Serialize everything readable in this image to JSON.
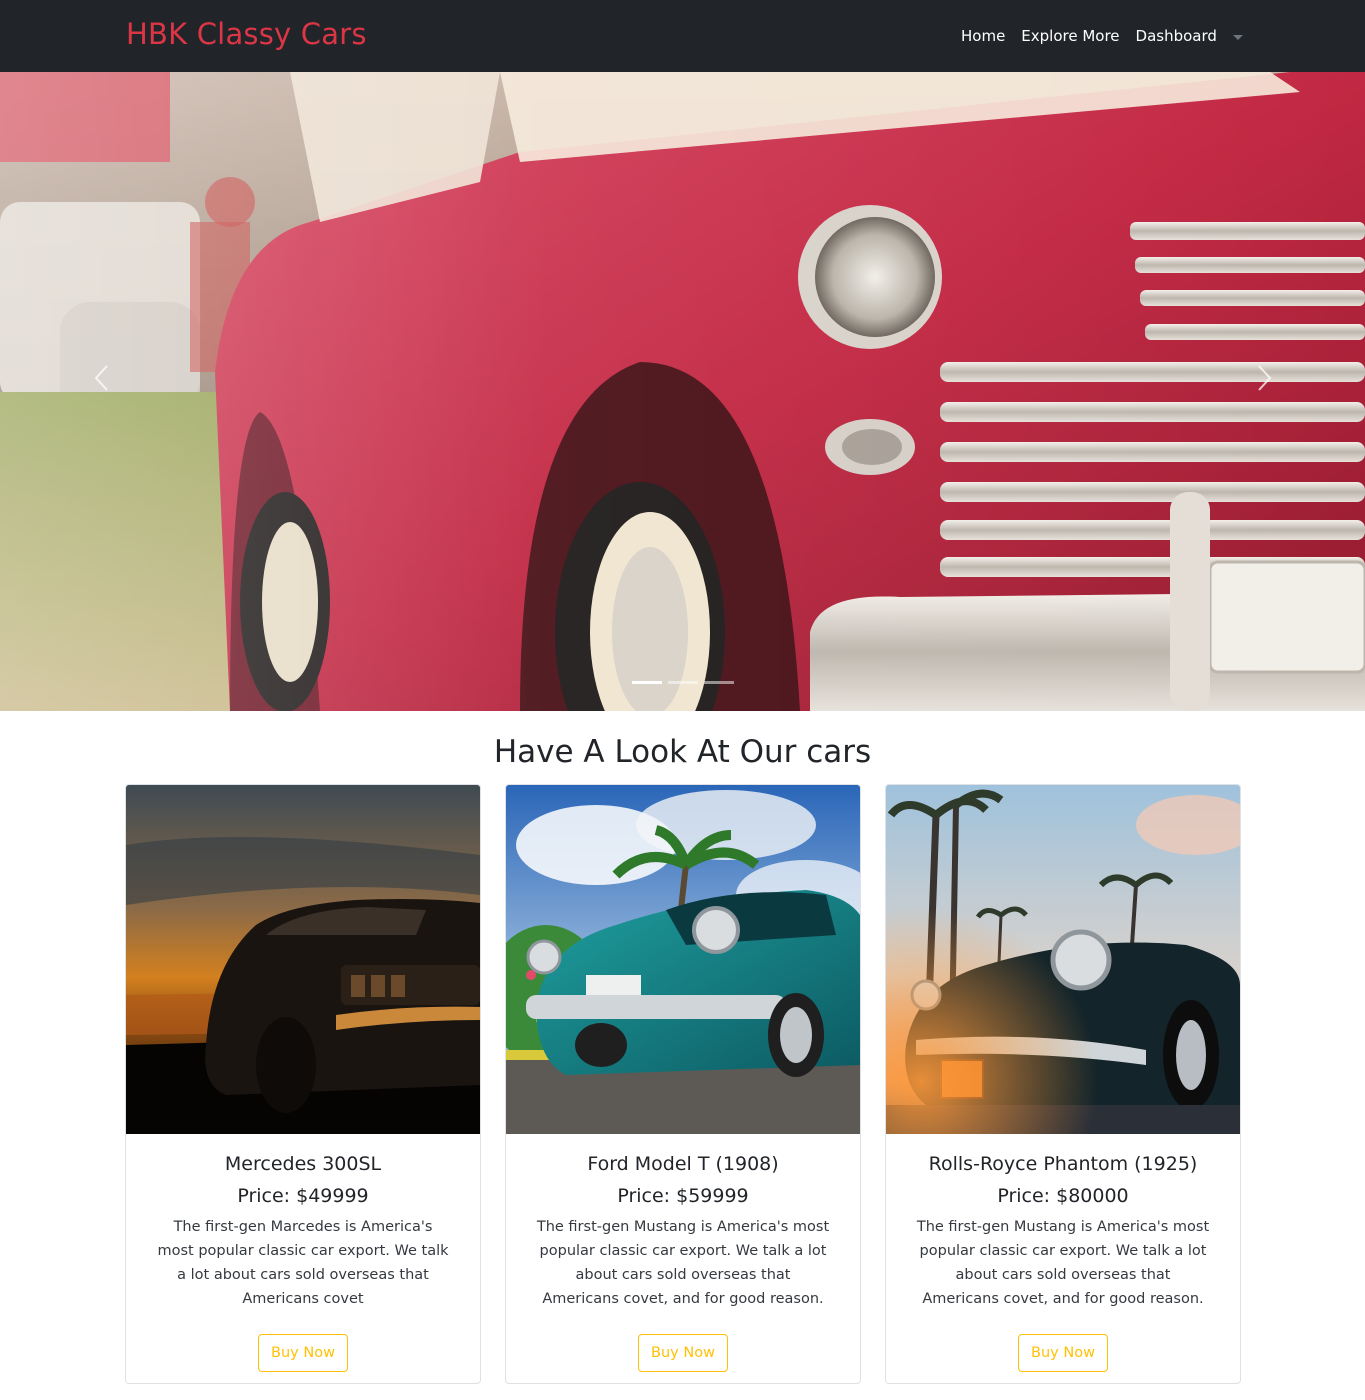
{
  "navbar": {
    "brand": "HBK Classy Cars",
    "links": [
      "Home",
      "Explore More",
      "Dashboard"
    ]
  },
  "hero": {
    "slide_count": 3,
    "active_slide": 1,
    "image": "red-vintage-car-photo"
  },
  "section": {
    "title": "Have A Look At Our cars"
  },
  "cards": [
    {
      "image": "black-muscle-car-sunset-photo",
      "title": "Mercedes 300SL",
      "price": "Price: $49999",
      "description": "The first-gen Marcedes is America's most popular classic car export. We talk a lot about cars sold overseas that Americans covet",
      "button": "Buy Now"
    },
    {
      "image": "teal-classic-car-palm-photo",
      "title": "Ford Model T (1908)",
      "price": "Price: $59999",
      "description": "The first-gen Mustang is America's most popular classic car export. We talk a lot about cars sold overseas that Americans covet, and for good reason.",
      "button": "Buy Now"
    },
    {
      "image": "dark-convertible-palm-trees-photo",
      "title": "Rolls-Royce Phantom (1925)",
      "price": "Price: $80000",
      "description": "The first-gen Mustang is America's most popular classic car export. We talk a lot about cars sold overseas that Americans covet, and for good reason.",
      "button": "Buy Now"
    }
  ],
  "colors": {
    "navbar_bg": "#212529",
    "brand": "#dc3545",
    "button_outline": "#ffc107"
  }
}
